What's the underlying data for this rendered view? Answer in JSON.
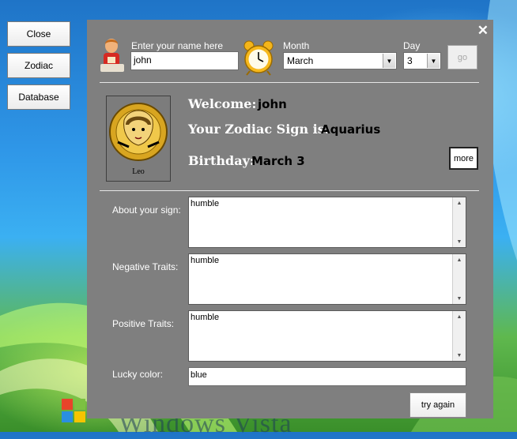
{
  "sidebar": {
    "close_label": "Close",
    "zodiac_label": "Zodiac",
    "database_label": "Database"
  },
  "background": {
    "text": "Windows Vista"
  },
  "header": {
    "name_label": "Enter your name here",
    "name_value": "john",
    "month_label": "Month",
    "month_value": "March",
    "day_label": "Day",
    "day_value": "3",
    "go_label": "go",
    "close_glyph": "✕"
  },
  "info": {
    "welcome_label": "Welcome:",
    "welcome_value": "john",
    "zodiac_label": "Your Zodiac Sign is:",
    "zodiac_value": "Aquarius",
    "birthday_label": "Birthday:",
    "birthday_value": "March 3",
    "image_caption": "Leo",
    "more_label": "more"
  },
  "details": {
    "about_label": "About your sign:",
    "about_value": "humble",
    "negative_label": "Negative Traits:",
    "negative_value": "humble",
    "positive_label": "Positive Traits:",
    "positive_value": "humble",
    "lucky_label": "Lucky color:",
    "lucky_value": "blue"
  },
  "footer": {
    "try_again_label": "try again"
  },
  "icons": {
    "user": "user-icon",
    "clock": "alarm-clock-icon",
    "dropdown": "chevron-down-icon",
    "scroll_up": "scroll-up-icon",
    "scroll_down": "scroll-down-icon"
  },
  "colors": {
    "panel": "#7f7f7f",
    "value_text": "#000000",
    "label_text": "#ffffff"
  }
}
